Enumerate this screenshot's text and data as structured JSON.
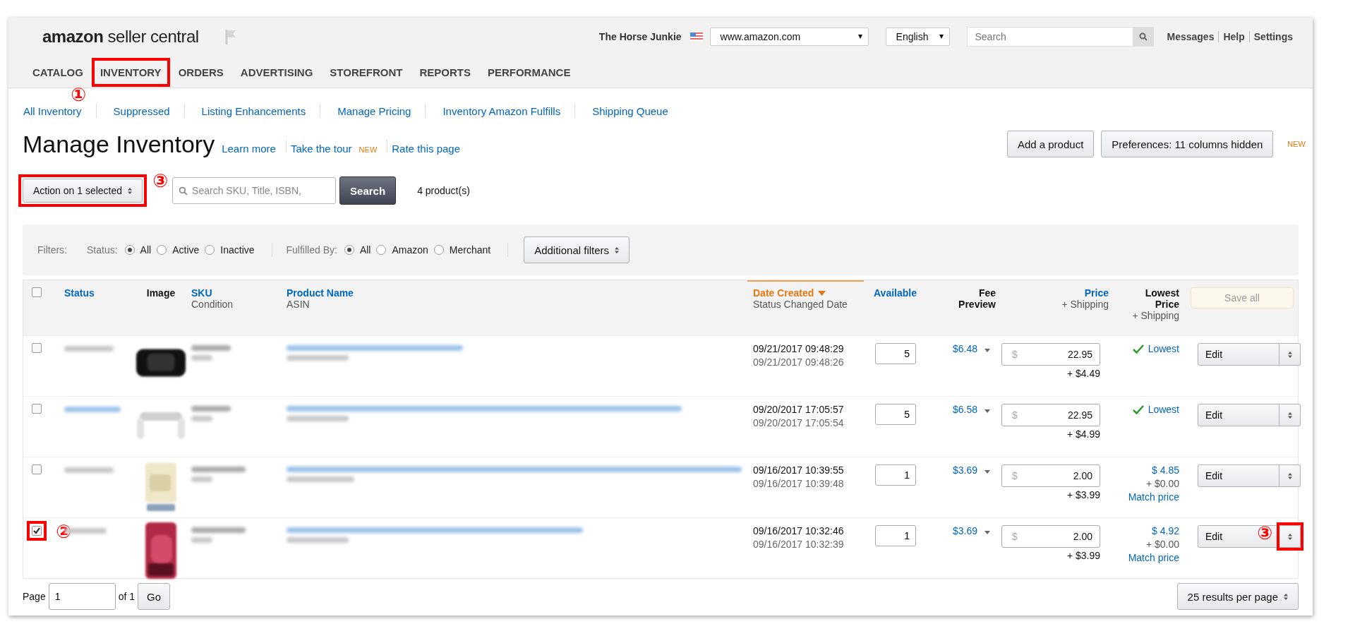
{
  "header": {
    "logo": {
      "brand": "amazon",
      "product": "seller central"
    },
    "store_name": "The Horse Junkie",
    "marketplace": "www.amazon.com",
    "language": "English",
    "search": {
      "placeholder": "Search"
    },
    "links": [
      "Messages",
      "Help",
      "Settings"
    ]
  },
  "nav": [
    {
      "label": "CATALOG",
      "highlighted": false
    },
    {
      "label": "INVENTORY",
      "highlighted": true,
      "callout": "①"
    },
    {
      "label": "ORDERS",
      "highlighted": false
    },
    {
      "label": "ADVERTISING",
      "highlighted": false
    },
    {
      "label": "STOREFRONT",
      "highlighted": false
    },
    {
      "label": "REPORTS",
      "highlighted": false
    },
    {
      "label": "PERFORMANCE",
      "highlighted": false
    }
  ],
  "subnav": [
    "All Inventory",
    "Suppressed",
    "Listing Enhancements",
    "Manage Pricing",
    "Inventory Amazon Fulfills",
    "Shipping Queue"
  ],
  "title": "Manage Inventory",
  "title_links": [
    {
      "label": "Learn more"
    },
    {
      "label": "Take the tour",
      "badge": "NEW"
    },
    {
      "label": "Rate this page"
    }
  ],
  "page_buttons": [
    {
      "label": "Add a product"
    },
    {
      "label": "Preferences: 11 columns hidden",
      "badge": "NEW"
    }
  ],
  "toolbar": {
    "action": {
      "label": "Action on 1 selected",
      "highlighted": true,
      "callout": "③"
    },
    "search": {
      "placeholder": "Search SKU, Title, ISBN,"
    },
    "search_button": "Search",
    "count": "4 product(s)"
  },
  "filters": {
    "label": "Filters:",
    "groups": [
      {
        "label": "Status:",
        "options": [
          {
            "label": "All",
            "selected": true
          },
          {
            "label": "Active",
            "selected": false
          },
          {
            "label": "Inactive",
            "selected": false
          }
        ]
      },
      {
        "label": "Fulfilled By:",
        "options": [
          {
            "label": "All",
            "selected": true
          },
          {
            "label": "Amazon",
            "selected": false
          },
          {
            "label": "Merchant",
            "selected": false
          }
        ]
      }
    ],
    "more": "Additional filters"
  },
  "table": {
    "select_all": {
      "checked": false
    },
    "columns": [
      {
        "label": "Status",
        "sortable": true,
        "sorted": false
      },
      {
        "label": "Image",
        "sortable": false,
        "sorted": false
      },
      {
        "label": "SKU",
        "sub": "Condition",
        "sortable": true,
        "sorted": false
      },
      {
        "label": "Product Name",
        "sub": "ASIN",
        "sortable": true,
        "sorted": false
      },
      {
        "label": "Date Created",
        "sub": "Status Changed Date",
        "sortable": true,
        "sorted": true
      },
      {
        "label": "Available",
        "sortable": true,
        "sorted": false
      },
      {
        "label": "Fee Preview",
        "sortable": false,
        "sorted": false
      },
      {
        "label": "Price",
        "sub": "+ Shipping",
        "sortable": true,
        "sorted": false
      },
      {
        "label": "Lowest Price",
        "sub": "+ Shipping",
        "sortable": false,
        "sorted": false
      }
    ],
    "save_all": {
      "label": "Save all",
      "disabled": true
    },
    "rows": [
      {
        "checked": false,
        "checkbox_highlighted": false,
        "date_created": "09/21/2017 09:48:29",
        "status_changed": "09/21/2017 09:48:26",
        "available": "5",
        "fee": "$6.48",
        "currency": "$",
        "price": "22.95",
        "shipping": "+ $4.49",
        "lowest": {
          "kind": "lowest",
          "label": "Lowest"
        },
        "action": "Edit",
        "toggle_highlighted": false
      },
      {
        "checked": false,
        "checkbox_highlighted": false,
        "date_created": "09/20/2017 17:05:57",
        "status_changed": "09/20/2017 17:05:54",
        "available": "5",
        "fee": "$6.58",
        "currency": "$",
        "price": "22.95",
        "shipping": "+ $4.99",
        "lowest": {
          "kind": "lowest",
          "label": "Lowest"
        },
        "action": "Edit",
        "toggle_highlighted": false
      },
      {
        "checked": false,
        "checkbox_highlighted": false,
        "date_created": "09/16/2017 10:39:55",
        "status_changed": "09/16/2017 10:39:48",
        "available": "1",
        "fee": "$3.69",
        "currency": "$",
        "price": "2.00",
        "shipping": "+ $3.99",
        "lowest": {
          "kind": "match",
          "price": "$ 4.85",
          "shipping": "+ $0.00",
          "link": "Match price"
        },
        "action": "Edit",
        "toggle_highlighted": false
      },
      {
        "checked": true,
        "checkbox_highlighted": true,
        "checkbox_callout": "②",
        "date_created": "09/16/2017 10:32:46",
        "status_changed": "09/16/2017 10:32:39",
        "available": "1",
        "fee": "$3.69",
        "currency": "$",
        "price": "2.00",
        "shipping": "+ $3.99",
        "lowest": {
          "kind": "match",
          "price": "$ 4.92",
          "shipping": "+ $0.00",
          "link": "Match price"
        },
        "action": "Edit",
        "toggle_highlighted": true,
        "toggle_callout": "③"
      }
    ]
  },
  "pagination": {
    "label": "Page",
    "value": "1",
    "of": "of 1",
    "go": "Go",
    "per_page": "25 results per page"
  }
}
